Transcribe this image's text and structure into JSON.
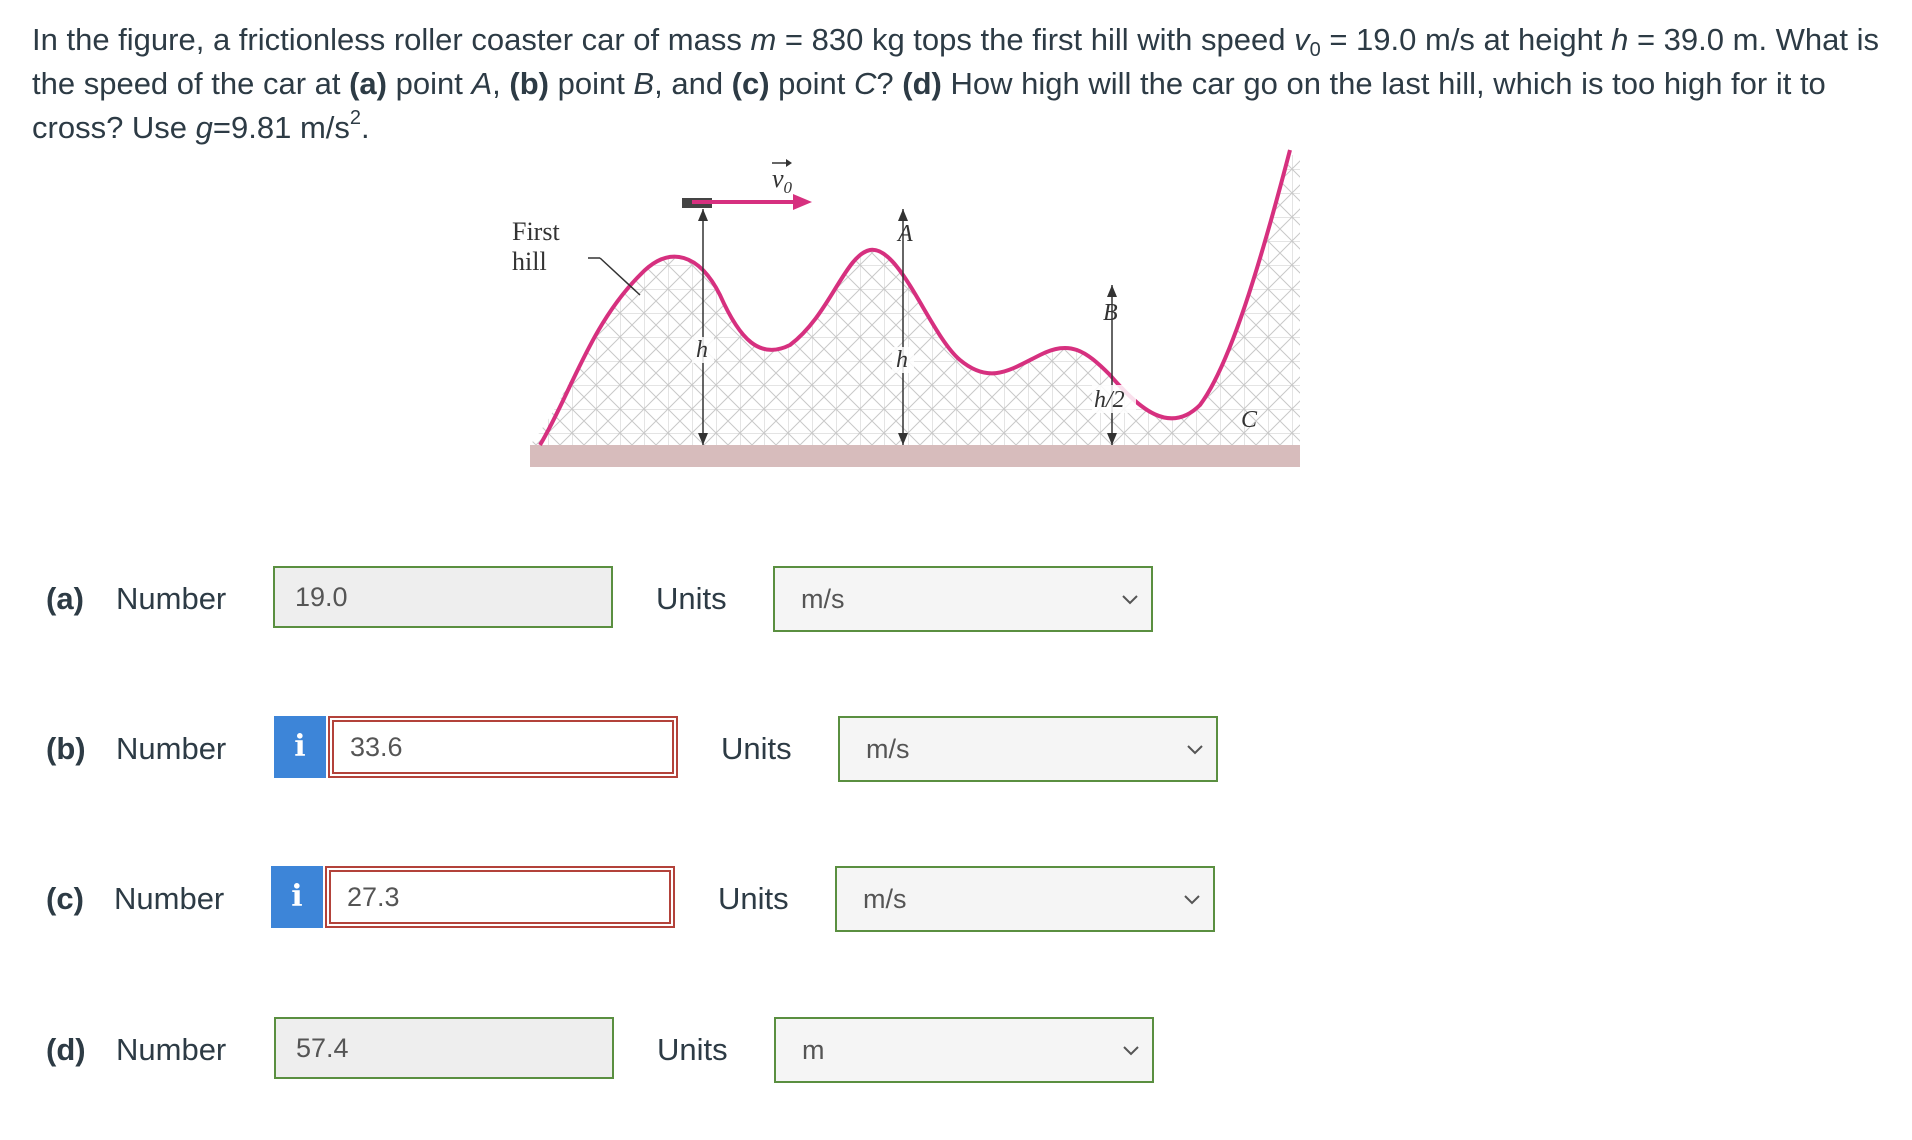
{
  "question": {
    "intro": "In the figure, a frictionless roller coaster car of mass ",
    "m_sym": "m",
    "m_val": " = 830 kg tops the first hill with speed ",
    "v_sym": "v",
    "v_sub": "0",
    "v_val": " = 19.0 m/s at height ",
    "h_sym": "h",
    "h_val": " = 39.0 m. What is the speed of the car at ",
    "a": "(a)",
    "pa": " point ",
    "A": "A",
    "c1": ", ",
    "b": "(b)",
    "pb": " point ",
    "B": "B",
    "and": ", and ",
    "c": "(c)",
    "pc": " point ",
    "C": "C",
    "q": "? ",
    "d": "(d)",
    "dtext": " How high will the car go on the last hill, which is too high for it to cross? Use ",
    "g_sym": "g",
    "g_val": "=9.81 m/s",
    "g_sup": "2",
    "end": "."
  },
  "figure": {
    "first_hill": "First",
    "first_hill_2": "hill",
    "v0": "v",
    "v0_sub": "0",
    "label_A": "A",
    "label_B": "B",
    "label_C": "C",
    "h1": "h",
    "h2": "h",
    "h_half": "h/2"
  },
  "colors": {
    "track": "#d6307f",
    "correct_border": "#5a8f40",
    "wrong_border": "#b3423a",
    "info_button": "#3d85d8"
  },
  "answers": [
    {
      "part": "(a)",
      "label": "Number",
      "value": "19.0",
      "status": "correct",
      "units_label": "Units",
      "unit": "m/s"
    },
    {
      "part": "(b)",
      "label": "Number",
      "value": "33.6",
      "status": "incorrect",
      "units_label": "Units",
      "unit": "m/s"
    },
    {
      "part": "(c)",
      "label": "Number",
      "value": "27.3",
      "status": "incorrect",
      "units_label": "Units",
      "unit": "m/s"
    },
    {
      "part": "(d)",
      "label": "Number",
      "value": "57.4",
      "status": "correct",
      "units_label": "Units",
      "unit": "m"
    }
  ],
  "info_icon": "i"
}
